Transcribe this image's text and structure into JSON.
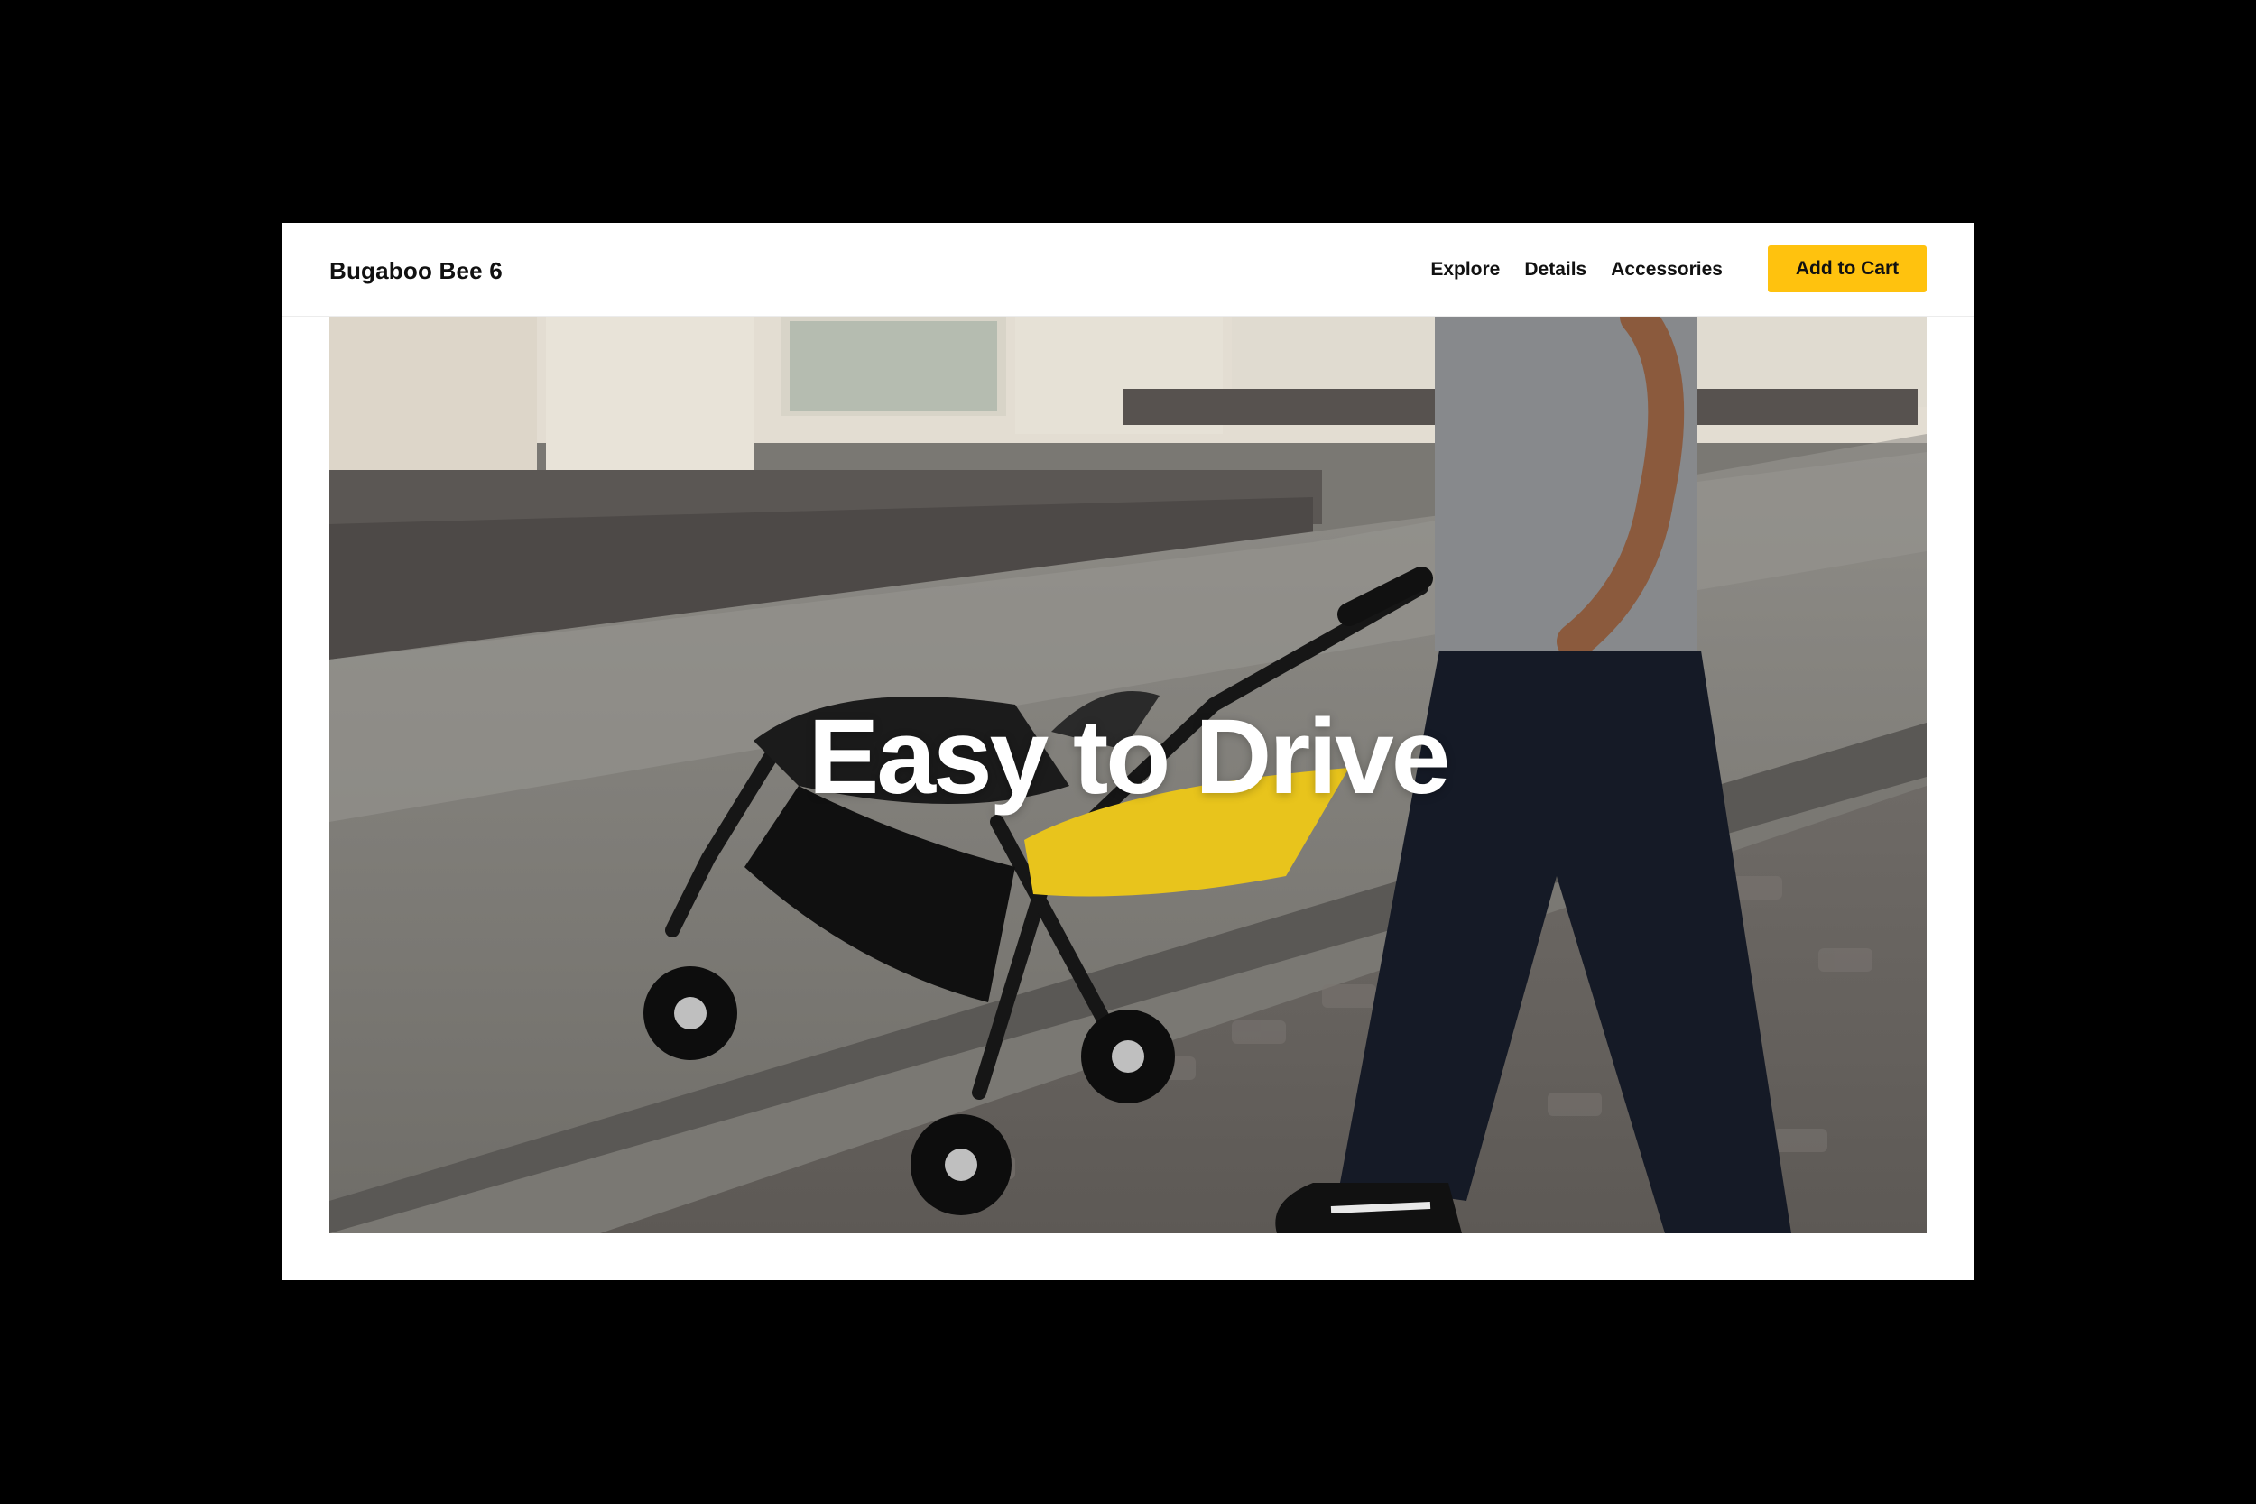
{
  "header": {
    "brand": "Bugaboo Bee 6",
    "nav": [
      {
        "label": "Explore"
      },
      {
        "label": "Details"
      },
      {
        "label": "Accessories"
      }
    ],
    "cta_label": "Add to Cart"
  },
  "hero": {
    "title": "Easy to Drive",
    "image_description_icon": "stroller-street-photo"
  },
  "colors": {
    "accent": "#ffc20e",
    "background": "#000000",
    "surface": "#ffffff",
    "text": "#111111"
  }
}
